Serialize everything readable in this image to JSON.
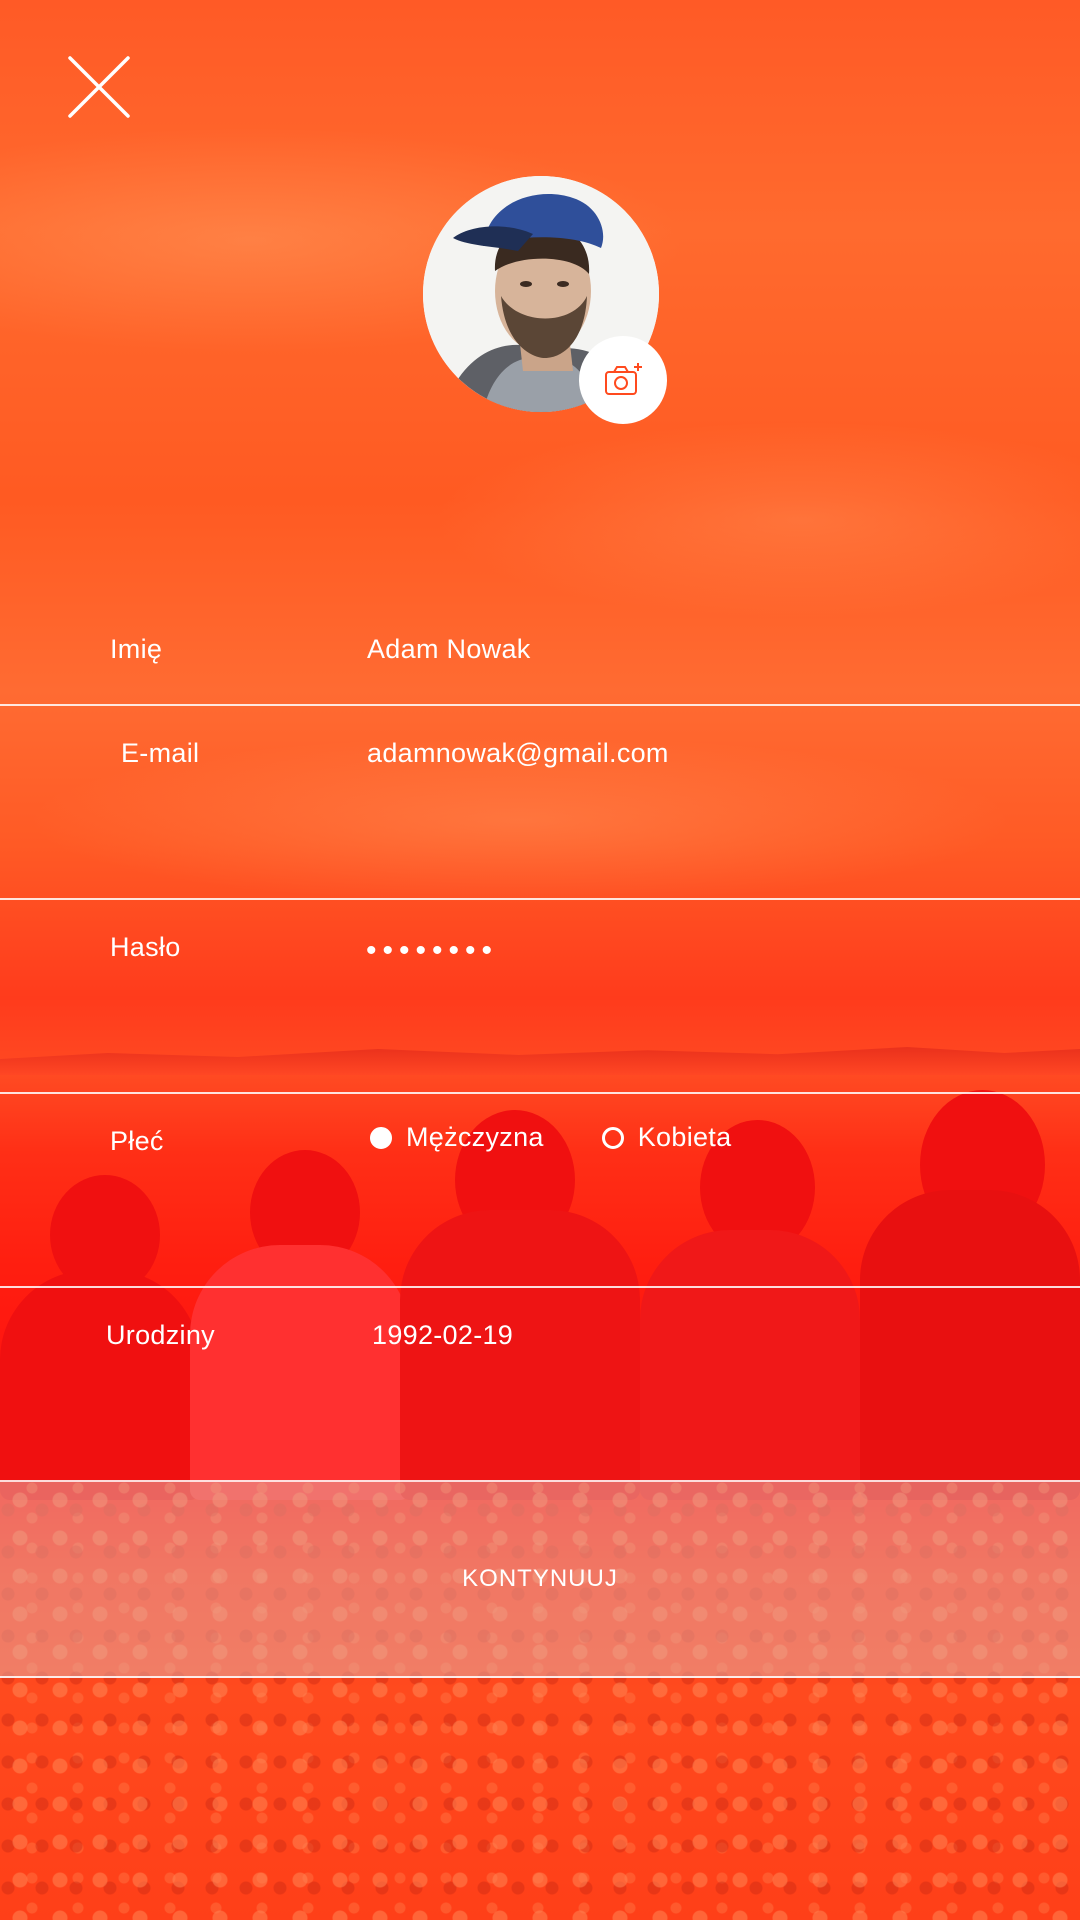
{
  "theme": {
    "accent": "#ff4a1e",
    "text": "#ffffff",
    "divider": "#ffffff",
    "button_overlay": "#e6aaa0"
  },
  "header": {
    "close_icon": "close-icon",
    "camera_icon": "camera-add-icon"
  },
  "form": {
    "name": {
      "label": "Imię",
      "value": "Adam Nowak"
    },
    "email": {
      "label": "E-mail",
      "value": "adamnowak@gmail.com"
    },
    "password": {
      "label": "Hasło",
      "value": "••••••••"
    },
    "gender": {
      "label": "Płeć",
      "options": [
        {
          "label": "Mężczyzna",
          "selected": true
        },
        {
          "label": "Kobieta",
          "selected": false
        }
      ]
    },
    "birthday": {
      "label": "Urodziny",
      "value": "1992-02-19"
    }
  },
  "actions": {
    "continue_label": "KONTYNUUJ"
  }
}
